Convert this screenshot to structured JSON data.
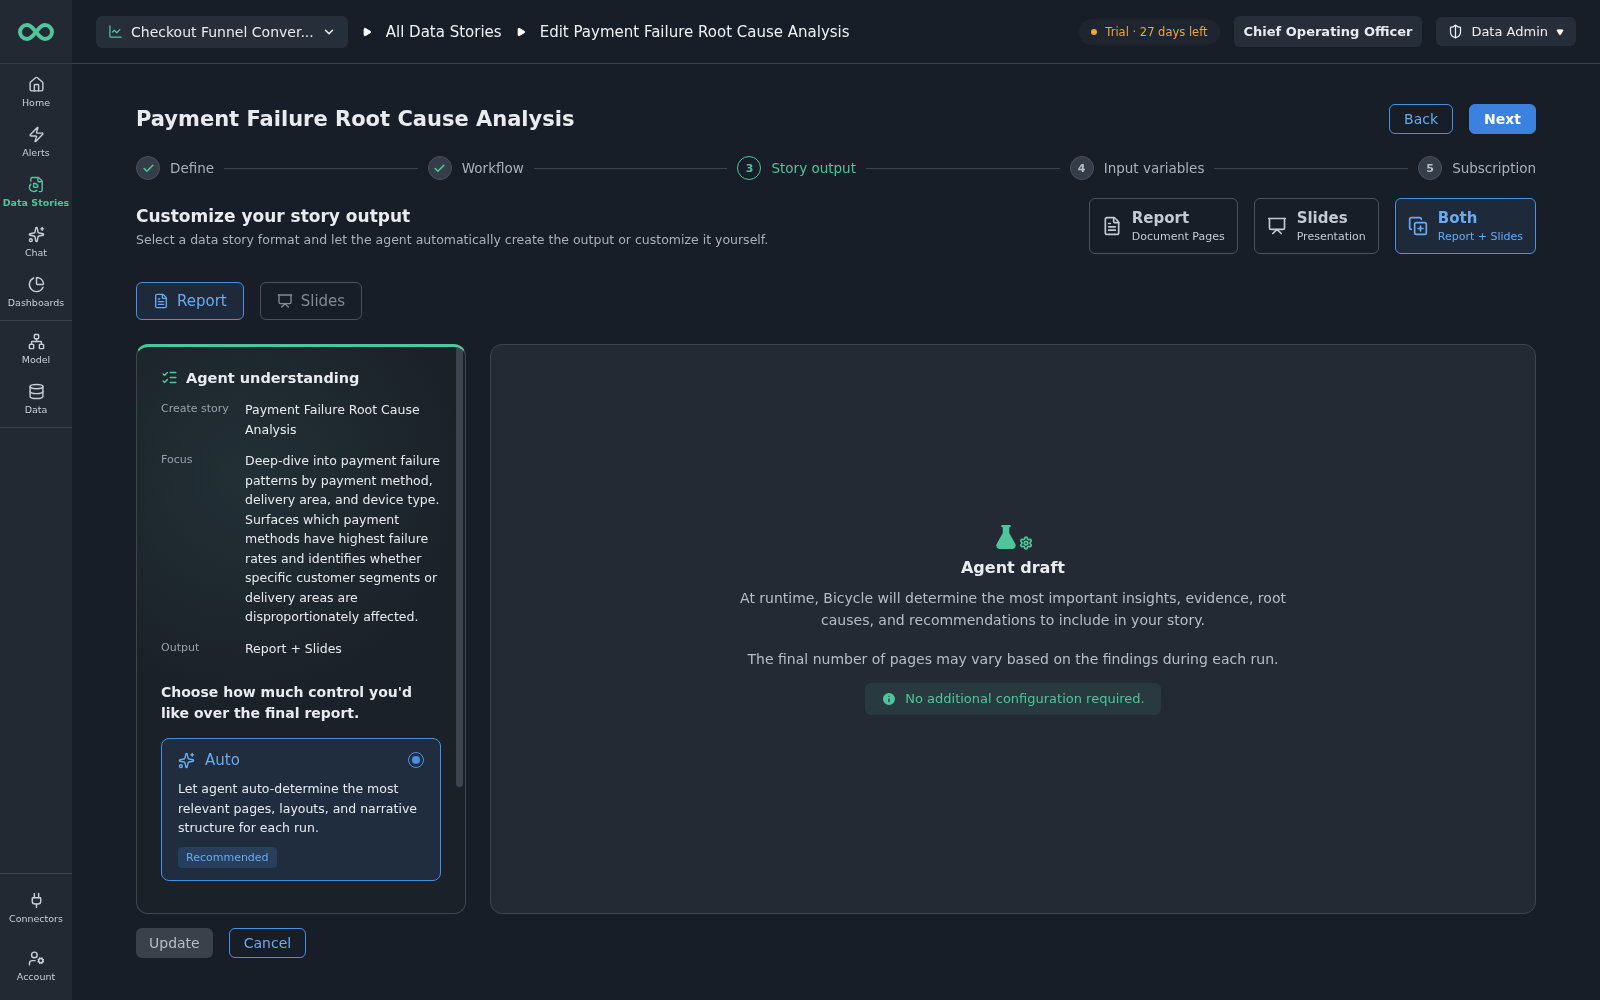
{
  "topbar": {
    "story_selector": "Checkout Funnel Conver...",
    "breadcrumbs": [
      "All Data Stories",
      "Edit Payment Failure Root Cause Analysis"
    ],
    "trial": "Trial · 27 days left",
    "role": "Chief Operating Officer",
    "user_menu": "Data Admin"
  },
  "sidebar": {
    "groups": [
      [
        {
          "label": "Home",
          "selected": false
        },
        {
          "label": "Alerts",
          "selected": false
        },
        {
          "label": "Data Stories",
          "selected": true
        },
        {
          "label": "Chat",
          "selected": false
        },
        {
          "label": "Dashboards",
          "selected": false
        }
      ],
      [
        {
          "label": "Model",
          "selected": false
        },
        {
          "label": "Data",
          "selected": false
        }
      ]
    ],
    "bottom": [
      {
        "label": "Connectors",
        "selected": false
      },
      {
        "label": "Account",
        "selected": false
      }
    ]
  },
  "page": {
    "title": "Payment Failure Root Cause Analysis",
    "buttons": {
      "back": "Back",
      "next": "Next"
    }
  },
  "stepper": [
    {
      "label": "Define",
      "completed": true,
      "selected": false
    },
    {
      "label": "Workflow",
      "completed": true,
      "selected": false
    },
    {
      "number": "3",
      "label": "Story output",
      "completed": false,
      "selected": true
    },
    {
      "number": "4",
      "label": "Input variables",
      "completed": false,
      "selected": false
    },
    {
      "number": "5",
      "label": "Subscription",
      "completed": false,
      "selected": false
    }
  ],
  "section": {
    "title": "Customize your story output",
    "subtitle": "Select a data story format and let the agent automatically create the output or customize it yourself."
  },
  "formats": [
    {
      "title": "Report",
      "subtitle": "Document Pages",
      "selected": false
    },
    {
      "title": "Slides",
      "subtitle": "Presentation",
      "selected": false
    },
    {
      "title": "Both",
      "subtitle": "Report + Slides",
      "selected": true
    }
  ],
  "tabs": [
    {
      "label": "Report",
      "selected": true
    },
    {
      "label": "Slides",
      "selected": false
    }
  ],
  "understanding": {
    "title": "Agent understanding",
    "rows": [
      {
        "label": "Create story",
        "value": "Payment Failure Root Cause Analysis"
      },
      {
        "label": "Focus",
        "value": "Deep-dive into payment failure patterns by payment method, delivery area, and device type. Surfaces which payment methods have highest failure rates and identifies whether specific customer segments or delivery areas are disproportionately affected."
      },
      {
        "label": "Output",
        "value": "Report + Slides"
      }
    ],
    "question": "Choose how much control you'd like over the final report.",
    "options": [
      {
        "title": "Auto",
        "description": "Let agent auto-determine the most relevant pages, layouts, and narrative structure for each run.",
        "badge": "Recommended",
        "selected": true
      }
    ]
  },
  "draft": {
    "title": "Agent draft",
    "text": "At runtime, Bicycle will determine the most important insights, evidence, root causes, and recommendations to include in your story.",
    "note": "The final number of pages may vary based on the findings during each run.",
    "info": "No additional configuration required."
  },
  "footer": {
    "update": "Update",
    "cancel": "Cancel"
  }
}
